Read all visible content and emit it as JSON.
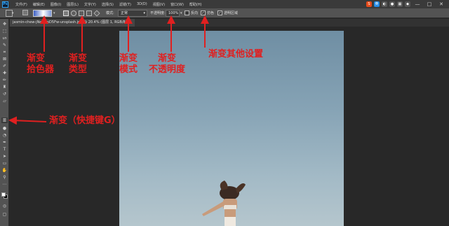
{
  "app": {
    "logo": "Ps"
  },
  "menu": [
    "文件(F)",
    "编辑(E)",
    "图像(I)",
    "图层(L)",
    "文字(Y)",
    "选择(S)",
    "滤镜(T)",
    "3D(D)",
    "视图(V)",
    "窗口(W)",
    "帮助(H)"
  ],
  "tray": {
    "ime": "S",
    "lang": "英"
  },
  "window_controls": {
    "minimize": "—",
    "maximize": "□",
    "close": "✕"
  },
  "options": {
    "mode_label": "模式:",
    "mode_value": "正常",
    "opacity_label": "不透明度:",
    "opacity_value": "100%",
    "reverse_label": "反向",
    "reverse_checked": false,
    "dither_label": "仿色",
    "dither_checked": true,
    "transparency_label": "透明区域",
    "transparency_checked": true,
    "checkmark": "✓",
    "caret": "▾"
  },
  "document": {
    "tab_title": "jasmin-chew-jNe4MpD5Fw-unsplash.jpg @ 20.4% (图层 1, RGB/8) *"
  },
  "annotations": {
    "gradient_picker": "渐变\n拾色器",
    "gradient_type": "渐变\n类型",
    "gradient_mode": "渐变\n模式",
    "gradient_opacity": "渐变\n不透明度",
    "gradient_other": "渐变其他设置",
    "gradient_tool": "渐变（快捷键G）"
  },
  "colors": {
    "annotation": "#e02020",
    "foreground": "#ffffff",
    "background": "#000000"
  }
}
